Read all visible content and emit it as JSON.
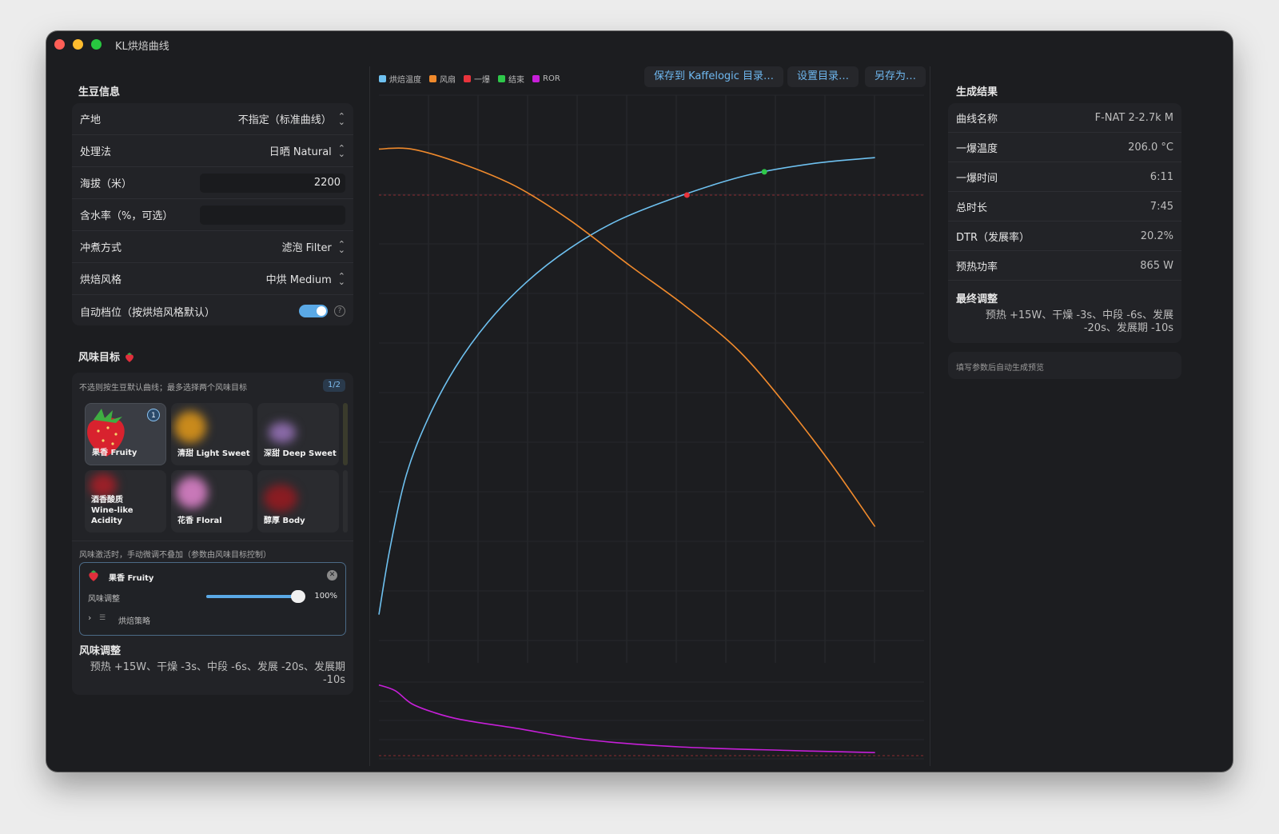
{
  "app": {
    "title": "KL烘焙曲线"
  },
  "bean": {
    "section_title": "生豆信息",
    "origin": {
      "label": "产地",
      "value": "不指定（标准曲线）"
    },
    "process": {
      "label": "处理法",
      "value": "日晒 Natural"
    },
    "altitude": {
      "label": "海拔（米）",
      "value": "2200"
    },
    "moisture": {
      "label": "含水率（%，可选）",
      "value": ""
    },
    "brew": {
      "label": "冲煮方式",
      "value": "滤泡 Filter"
    },
    "roast_style": {
      "label": "烘焙风格",
      "value": "中烘 Medium"
    },
    "auto_gear": {
      "label": "自动档位（按烘焙风格默认）",
      "on": true
    }
  },
  "flavor": {
    "section_title": "风味目标",
    "title_icon": "strawberry-icon",
    "hint": "不选则按生豆默认曲线；最多选择两个风味目标",
    "count": "1/2",
    "tiles": [
      {
        "label": "果香 Fruity",
        "selected": true,
        "badge": "1"
      },
      {
        "label": "清甜 Light Sweet"
      },
      {
        "label": "深甜 Deep Sweet"
      },
      {
        "label_line1": "酒香酸质",
        "label_line2": "Wine-like Acidity"
      },
      {
        "label": "花香 Floral"
      },
      {
        "label": "醇厚 Body"
      }
    ],
    "note": "风味激活时，手动微调不叠加（参数由风味目标控制）",
    "active": {
      "name": "果香 Fruity",
      "adjust_label": "风味调整",
      "adjust_value": "100%",
      "adjust_level": 1.0,
      "strategy_label": "烘焙策略"
    },
    "adjust_title": "风味调整",
    "adjust_text": "预热 +15W、干燥 -3s、中段 -6s、发展 -20s、发展期 -10s"
  },
  "chart": {
    "legend": [
      {
        "name": "烘焙温度",
        "color": "#6ec1f0"
      },
      {
        "name": "风扇",
        "color": "#f08a2c"
      },
      {
        "name": "一爆",
        "color": "#e8343c"
      },
      {
        "name": "结束",
        "color": "#2ec84a"
      },
      {
        "name": "ROR",
        "color": "#c71fd9"
      }
    ],
    "buttons": {
      "save_kaffelogic": "保存到 Kaffelogic 目录…",
      "set_dir": "设置目录…",
      "save_as": "另存为…"
    }
  },
  "chart_data": {
    "type": "line",
    "xlim": [
      0,
      1
    ],
    "ylim": [
      0,
      1
    ],
    "series": [
      {
        "name": "烘焙温度",
        "color": "#6ec1f0",
        "x": [
          0,
          0.02,
          0.05,
          0.09,
          0.14,
          0.2,
          0.27,
          0.35,
          0.44,
          0.56,
          0.68,
          0.8,
          0.91
        ],
        "y": [
          0.085,
          0.2,
          0.33,
          0.43,
          0.52,
          0.6,
          0.67,
          0.73,
          0.78,
          0.825,
          0.86,
          0.88,
          0.89
        ]
      },
      {
        "name": "风扇",
        "color": "#f08a2c",
        "x": [
          0,
          0.06,
          0.15,
          0.25,
          0.35,
          0.46,
          0.56,
          0.66,
          0.75,
          0.83,
          0.91
        ],
        "y": [
          0.905,
          0.905,
          0.88,
          0.84,
          0.78,
          0.7,
          0.63,
          0.55,
          0.45,
          0.35,
          0.24
        ]
      },
      {
        "name": "ROR",
        "color": "#c71fd9",
        "x": [
          0,
          0.03,
          0.06,
          0.1,
          0.15,
          0.25,
          0.38,
          0.55,
          0.75,
          0.91
        ],
        "y": [
          0.96,
          0.88,
          0.7,
          0.58,
          0.48,
          0.36,
          0.2,
          0.1,
          0.05,
          0.02
        ]
      }
    ],
    "markers": [
      {
        "name": "一爆",
        "x": 0.565,
        "y": 0.824,
        "color": "#e8343c"
      },
      {
        "name": "结束",
        "x": 0.707,
        "y": 0.865,
        "color": "#2ec84a"
      }
    ],
    "first_crack_ref": 0.824
  },
  "results": {
    "section_title": "生成结果",
    "rows": [
      {
        "label": "曲线名称",
        "value": "F-NAT 2-2.7k M"
      },
      {
        "label": "一爆温度",
        "value": "206.0 °C"
      },
      {
        "label": "一爆时间",
        "value": "6:11"
      },
      {
        "label": "总时长",
        "value": "7:45"
      },
      {
        "label": "DTR（发展率）",
        "value": "20.2%"
      },
      {
        "label": "预热功率",
        "value": "865 W"
      }
    ],
    "final_label": "最终调整",
    "final_text": "预热 +15W、干燥 -3s、中段 -6s、发展 -20s、发展期 -10s",
    "preview_note": "填写参数后自动生成预览"
  }
}
